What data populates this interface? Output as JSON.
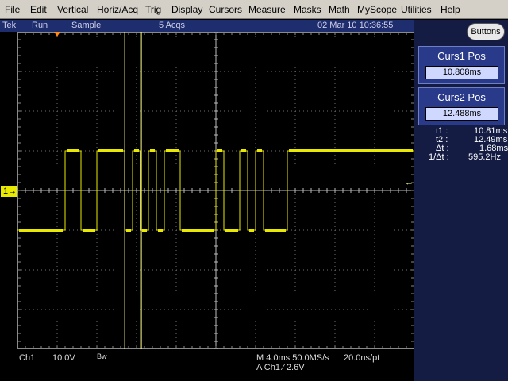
{
  "menu": [
    "File",
    "Edit",
    "Vertical",
    "Horiz/Acq",
    "Trig",
    "Display",
    "Cursors",
    "Measure",
    "Masks",
    "Math",
    "MyScope",
    "Utilities",
    "Help"
  ],
  "status": {
    "brand": "Tek",
    "run_state": "Run",
    "acq_mode": "Sample",
    "acqs": "5 Acqs",
    "datetime": "02 Mar 10 10:36:55"
  },
  "buttons_label": "Buttons",
  "cursor1": {
    "title": "Curs1 Pos",
    "value": "10.808ms"
  },
  "cursor2": {
    "title": "Curs2 Pos",
    "value": "12.488ms"
  },
  "readouts": [
    {
      "label": "t1 :",
      "value": "10.81ms"
    },
    {
      "label": "t2 :",
      "value": "12.49ms"
    },
    {
      "label": "Δt :",
      "value": "1.68ms"
    },
    {
      "label": "1/Δt :",
      "value": "595.2Hz"
    }
  ],
  "channel": {
    "marker": "1",
    "name": "Ch1",
    "scale": "10.0V",
    "bw": "Bw"
  },
  "timebase": {
    "line1": "M 4.0ms 50.0MS/s",
    "line2": "A  Ch1  ⁄  2.6V",
    "pt": "20.0ns/pt"
  },
  "colors": {
    "trace": "#e8e800",
    "background": "#000000",
    "grid": "#8a8a8a",
    "cursor": "#ffff88"
  },
  "trace_levels_divisions": {
    "high": 1.0,
    "low": -1.0
  },
  "trace_transitions_ms": [
    4.8,
    6.4,
    8.0,
    10.8,
    11.6,
    12.4,
    13.2,
    14.0,
    14.8,
    16.4,
    20.0,
    20.8,
    22.4,
    23.2,
    24.0,
    24.8,
    27.2
  ]
}
